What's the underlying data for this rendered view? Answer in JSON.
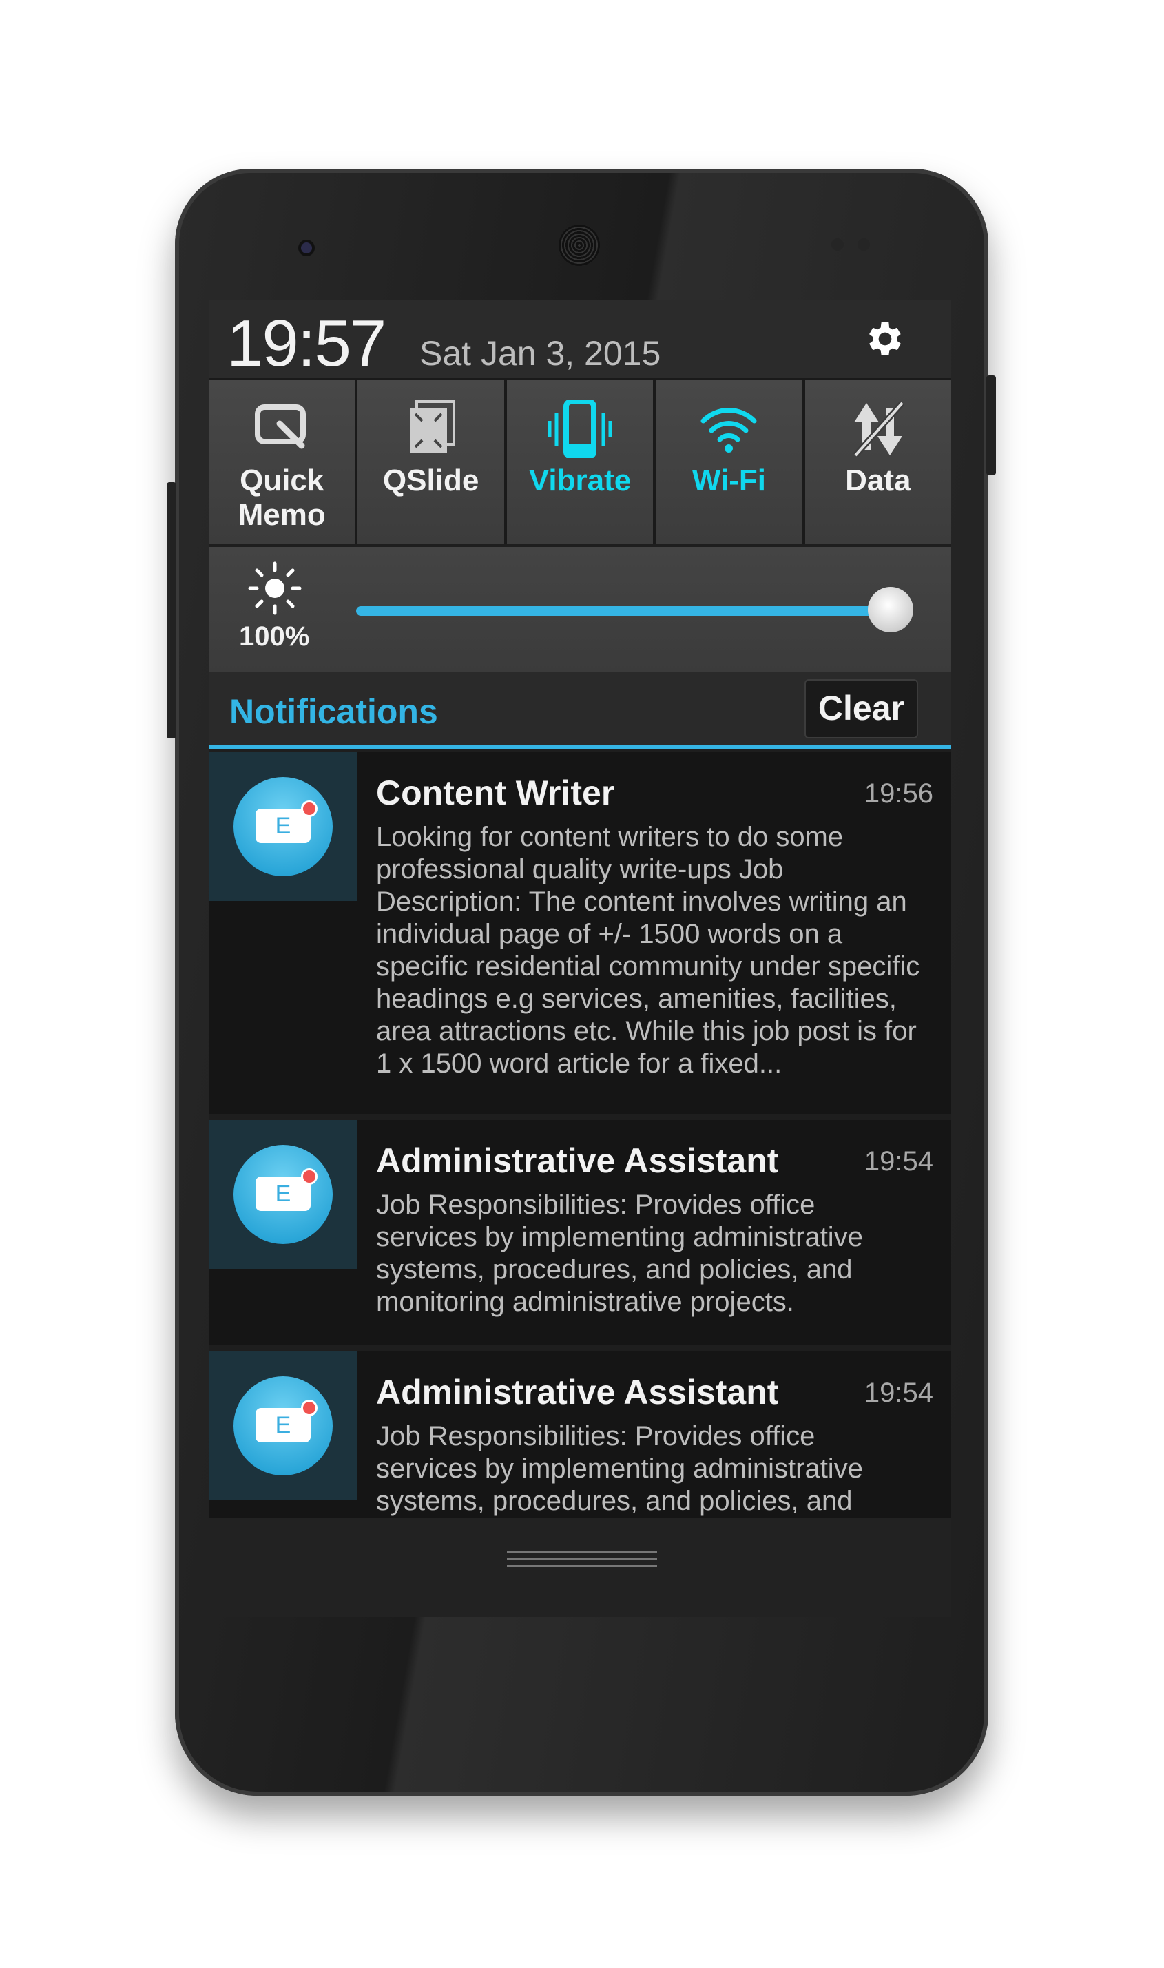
{
  "status": {
    "time": "19:57",
    "date": "Sat Jan 3, 2015"
  },
  "quick_settings": [
    {
      "label": "Quick Memo",
      "icon": "quick-memo-icon",
      "active": false
    },
    {
      "label": "QSlide",
      "icon": "qslide-icon",
      "active": false
    },
    {
      "label": "Vibrate",
      "icon": "vibrate-icon",
      "active": true
    },
    {
      "label": "Wi-Fi",
      "icon": "wifi-icon",
      "active": true
    },
    {
      "label": "Data",
      "icon": "data-off-icon",
      "active": false
    }
  ],
  "brightness": {
    "value_label": "100%",
    "value": 100
  },
  "notifications_header": {
    "title": "Notifications",
    "clear_label": "Clear"
  },
  "notifications": [
    {
      "title": "Content Writer",
      "time": "19:56",
      "body": "Looking for content writers to do some professional quality write-ups Job Description: The content involves writing an individual page of +/- 1500 words on a specific residential community under specific headings e.g services, amenities, facilities, area attractions etc. While this job post is for 1 x 1500 word article for a fixed...",
      "icon_letter": "E"
    },
    {
      "title": "Administrative Assistant",
      "time": "19:54",
      "body": "Job Responsibilities: Provides office services by implementing administrative systems, procedures, and policies, and monitoring administrative projects.",
      "icon_letter": "E"
    },
    {
      "title": "Administrative Assistant",
      "time": "19:54",
      "body": "Job Responsibilities: Provides office services by implementing administrative systems, procedures, and policies, and",
      "icon_letter": "E"
    }
  ],
  "colors": {
    "accent": "#33b5e5",
    "active_tile": "#10d8ee",
    "background": "#1e1e1e"
  }
}
